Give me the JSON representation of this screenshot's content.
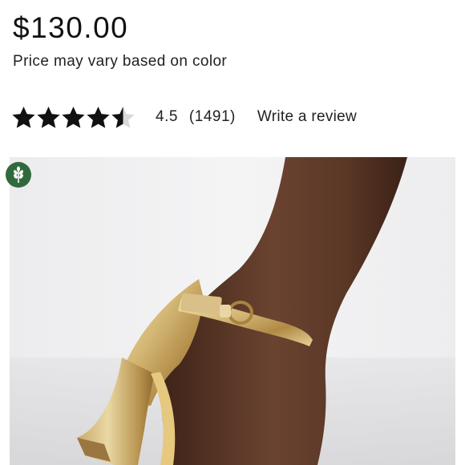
{
  "product": {
    "price": "$130.00",
    "price_note": "Price may vary based on color"
  },
  "rating": {
    "value": "4.5",
    "stars_filled": 4.5,
    "stars_total": 5,
    "count": "(1491)",
    "write_review_label": "Write a review"
  },
  "image": {
    "badge_icon": "wheat-icon",
    "colors": {
      "badge": "#2f6a3d",
      "star": "#111111",
      "star_empty": "#d9d9d9",
      "skin": "#5a3a2a",
      "metallic": "#d8c088"
    }
  }
}
